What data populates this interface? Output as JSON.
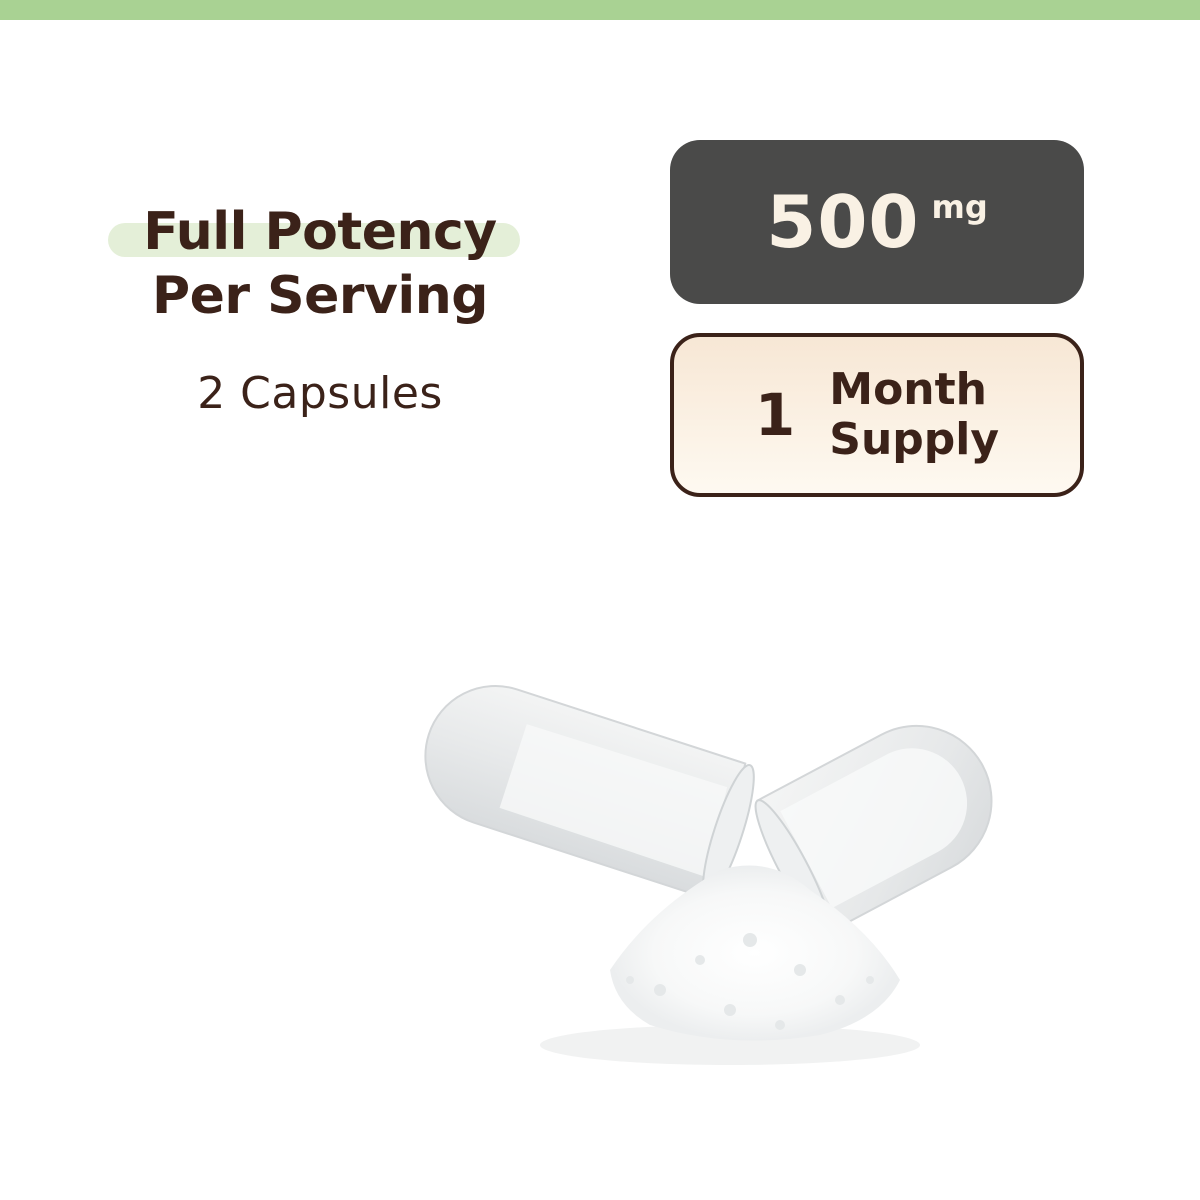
{
  "header": {
    "accent_color": "#a9d293"
  },
  "potency": {
    "line1": "Full Potency",
    "line2": "Per Serving",
    "serving": "2 Capsules",
    "text_color": "#3b2219",
    "highlight_color": "#e4efd8"
  },
  "dose_badge": {
    "value": "500",
    "unit": "mg",
    "background": "#4a4a49"
  },
  "supply_badge": {
    "number": "1",
    "line1": "Month",
    "line2": "Supply"
  },
  "product_image": {
    "icon": "open-capsule-powder-icon"
  }
}
